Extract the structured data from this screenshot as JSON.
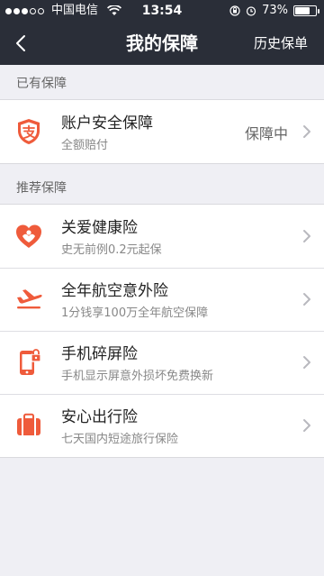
{
  "status_bar": {
    "carrier": "中国电信",
    "time": "13:54",
    "battery_text": "73%",
    "battery_level": 0.73
  },
  "navbar": {
    "back_icon": "chevron-left-icon",
    "title": "我的保障",
    "right_action": "历史保单"
  },
  "owned_section": {
    "header": "已有保障",
    "items": [
      {
        "icon": "alipay-shield-icon",
        "title": "账户安全保障",
        "subtitle": "全额赔付",
        "status": "保障中"
      }
    ]
  },
  "recommended_section": {
    "header": "推荐保障",
    "items": [
      {
        "icon": "heart-hands-icon",
        "title": "关爱健康险",
        "subtitle": "史无前例0.2元起保"
      },
      {
        "icon": "airplane-icon",
        "title": "全年航空意外险",
        "subtitle": "1分钱享100万全年航空保障"
      },
      {
        "icon": "phone-lock-icon",
        "title": "手机碎屏险",
        "subtitle": "手机显示屏意外损坏免费换新"
      },
      {
        "icon": "suitcase-icon",
        "title": "安心出行险",
        "subtitle": "七天国内短途旅行保险"
      }
    ]
  },
  "colors": {
    "accent": "#ef5b3b",
    "nav_bg": "#2a2e38",
    "page_bg": "#efeff4"
  }
}
